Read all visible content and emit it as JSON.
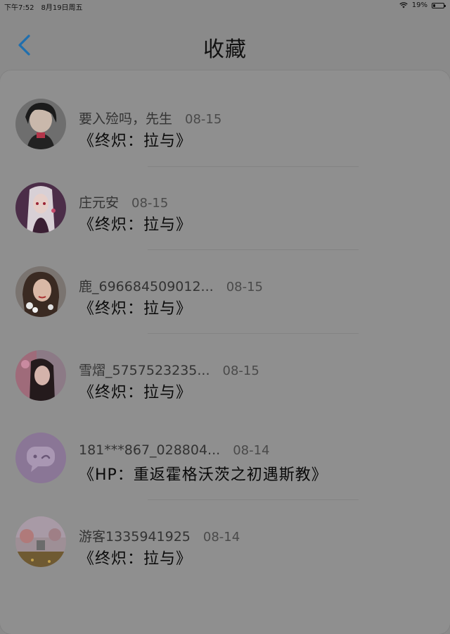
{
  "status": {
    "time": "下午7:52",
    "date": "8月19日周五",
    "battery": "19%",
    "battery_level": 0.19
  },
  "nav": {
    "title": "收藏",
    "back_icon": "chevron-left-icon",
    "accent": "#1f6fae"
  },
  "items": [
    {
      "user": "要入殓吗，先生",
      "date": "08-15",
      "work": "《终炽：拉与》",
      "avatar": "anime-boy"
    },
    {
      "user": "庄元安",
      "date": "08-15",
      "work": "《终炽：拉与》",
      "avatar": "anime-girl"
    },
    {
      "user": "鹿_696684509012...",
      "date": "08-15",
      "work": "《终炽：拉与》",
      "avatar": "portrait-girl"
    },
    {
      "user": "雪熠_5757523235...",
      "date": "08-15",
      "work": "《终炽：拉与》",
      "avatar": "photo-girl"
    },
    {
      "user": "181***867_028804...",
      "date": "08-14",
      "work": "《HP：重返霍格沃茨之初遇斯教》",
      "avatar": "default-chat"
    },
    {
      "user": "游客1335941925",
      "date": "08-14",
      "work": "《终炽：拉与》",
      "avatar": "landscape"
    }
  ]
}
